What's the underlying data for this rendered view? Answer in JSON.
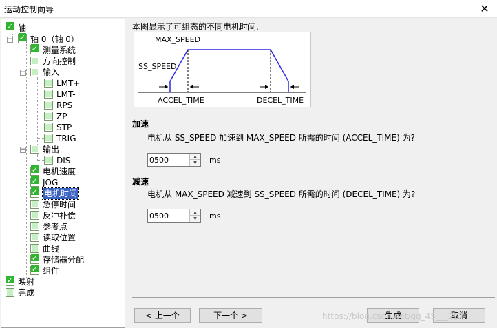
{
  "window": {
    "title": "运动控制向导",
    "close_glyph": "✕"
  },
  "tree": {
    "root_axis": "轴",
    "axis0": "轴 0（轴 0）",
    "measure": "测量系统",
    "direction": "方向控制",
    "input": "输入",
    "lmt_plus": "LMT+",
    "lmt_minus": "LMT-",
    "rps": "RPS",
    "zp": "ZP",
    "stp": "STP",
    "trig": "TRIG",
    "output": "输出",
    "dis": "DIS",
    "motor_speed": "电机速度",
    "jog": "JOG",
    "motor_time": "电机时间",
    "estop_time": "急停时间",
    "backlash": "反冲补偿",
    "reference": "参考点",
    "read_pos": "读取位置",
    "curve": "曲线",
    "memory": "存储器分配",
    "component": "组件",
    "mapping": "映射",
    "finish": "完成"
  },
  "panel": {
    "description": "本图显示了可组态的不同电机时间.",
    "diagram": {
      "max_speed": "MAX_SPEED",
      "ss_speed": "SS_SPEED",
      "accel_time": "ACCEL_TIME",
      "decel_time": "DECEL_TIME"
    },
    "accel": {
      "title": "加速",
      "question": "电机从 SS_SPEED 加速到 MAX_SPEED 所需的时间 (ACCEL_TIME) 为?",
      "value": "0500",
      "unit": "ms"
    },
    "decel": {
      "title": "减速",
      "question": "电机从 MAX_SPEED 减速到 SS_SPEED 所需的时间 (DECEL_TIME) 为?",
      "value": "0500",
      "unit": "ms"
    }
  },
  "buttons": {
    "prev": "< 上一个",
    "next": "下一个 >",
    "generate": "生成",
    "cancel": "取消"
  },
  "watermark": "https://blog.csdn.net/qq_45___217"
}
